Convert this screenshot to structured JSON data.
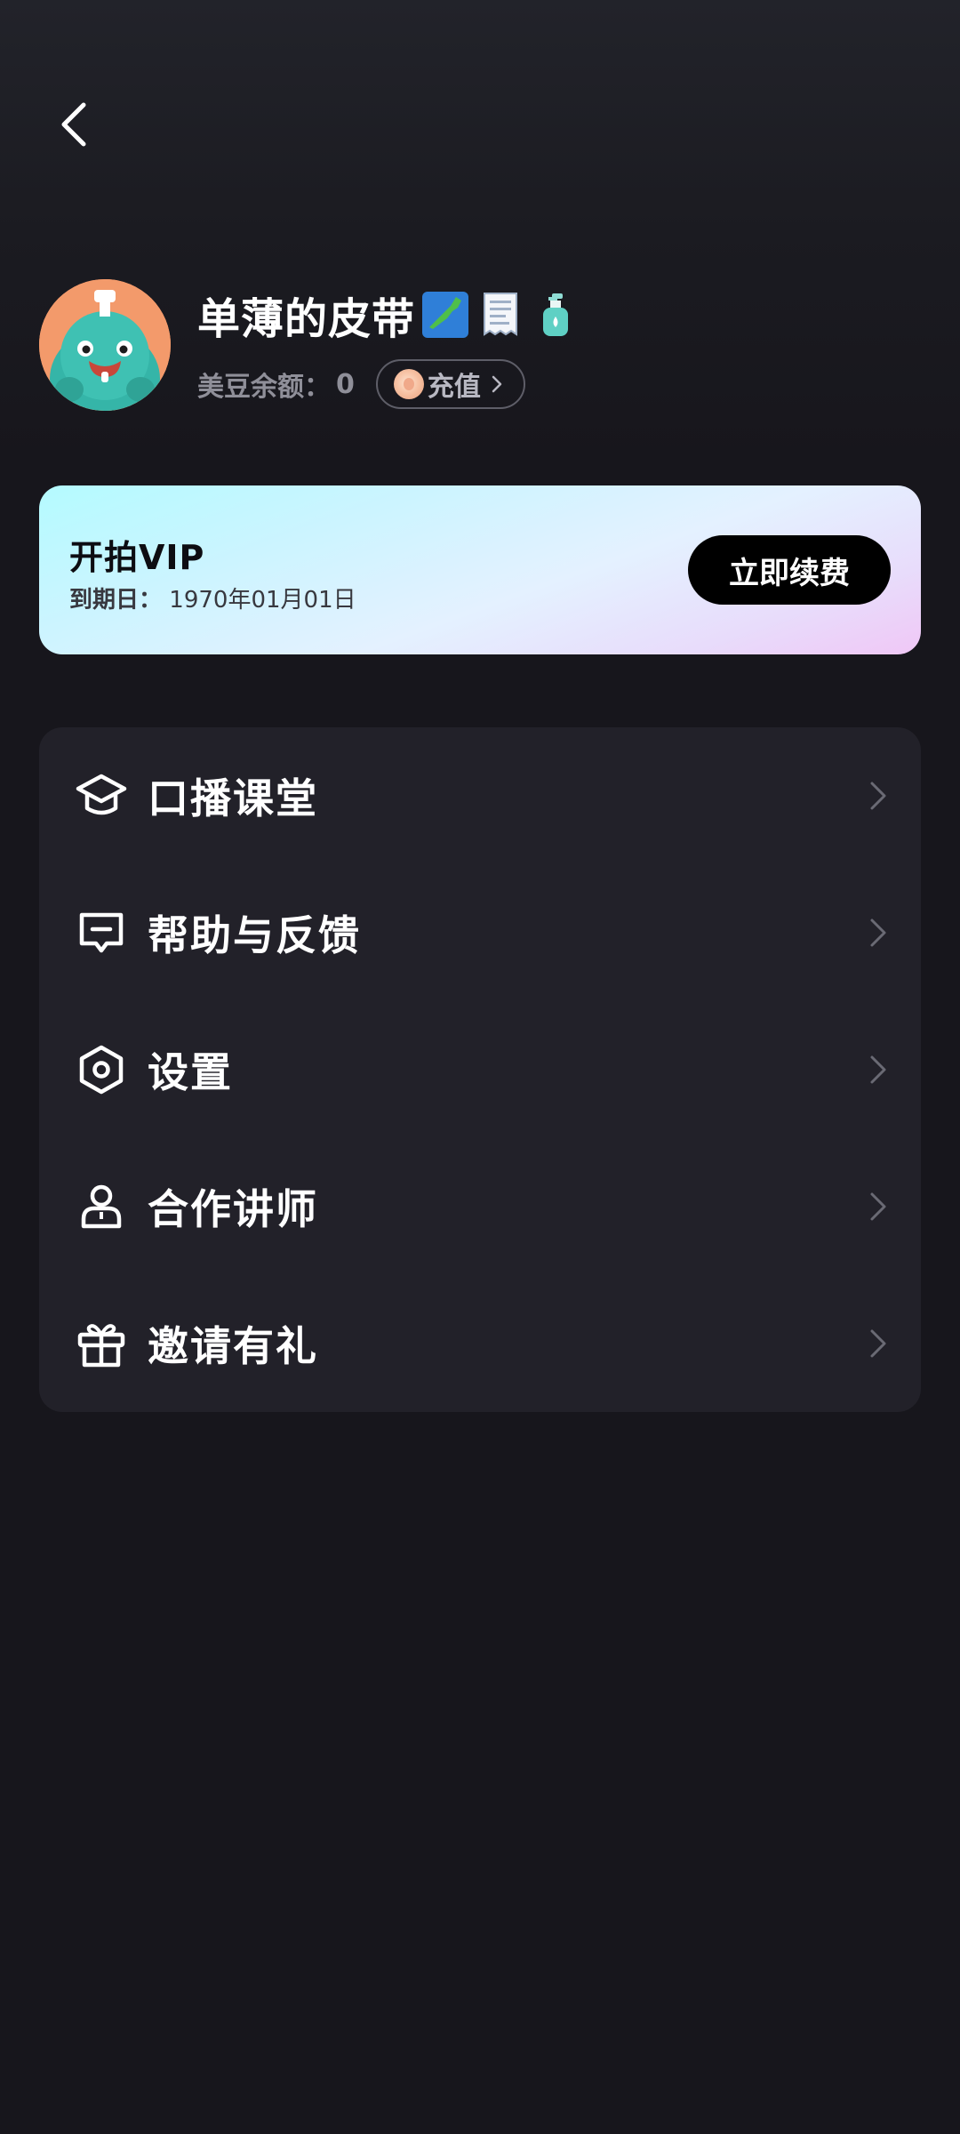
{
  "profile": {
    "username": "单薄的皮带",
    "username_emojis": [
      "japan-map-emoji",
      "receipt-emoji",
      "lotion-bottle-emoji"
    ],
    "balance_label": "美豆余额：",
    "balance_value": "0",
    "recharge_label": "充值"
  },
  "vip": {
    "title": "开拍VIP",
    "expiry_label": "到期日：",
    "expiry_date": "1970年01月01日",
    "renew_label": "立即续费"
  },
  "menu": {
    "items": [
      {
        "label": "口播课堂",
        "icon": "graduation-cap-icon"
      },
      {
        "label": "帮助与反馈",
        "icon": "feedback-icon"
      },
      {
        "label": "设置",
        "icon": "settings-icon"
      },
      {
        "label": "合作讲师",
        "icon": "lecturer-icon"
      },
      {
        "label": "邀请有礼",
        "icon": "gift-icon"
      }
    ]
  },
  "colors": {
    "background": "#17161c",
    "menu_card": "#222129",
    "vip_gradient_start": "#b4fbff",
    "vip_gradient_end": "#f0c7f6",
    "renew_button": "#000000",
    "muted_text": "#8f8f99"
  }
}
